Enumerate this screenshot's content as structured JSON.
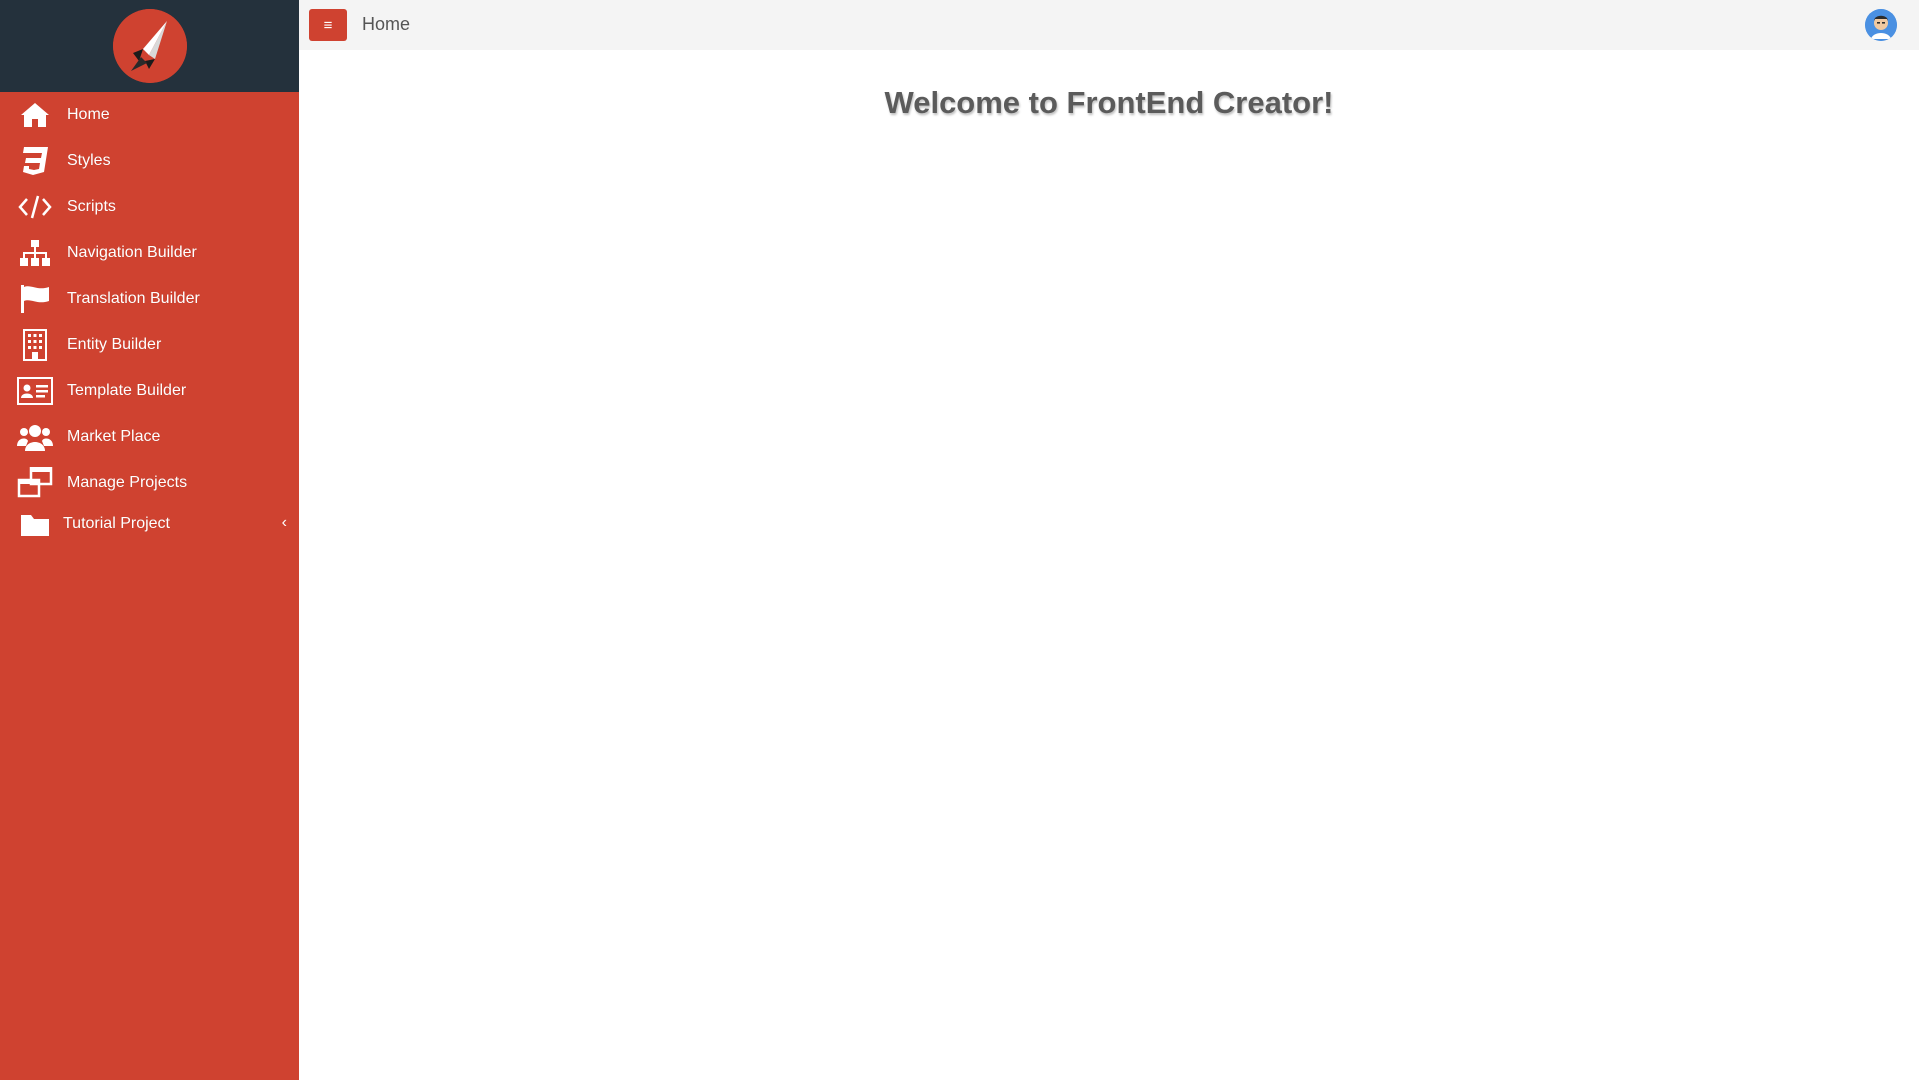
{
  "app": {
    "logo_icon": "rocket-logo-icon",
    "accent_color": "#cf4230",
    "sidebar_header_color": "#24313c"
  },
  "sidebar": {
    "items": [
      {
        "label": "Home",
        "icon": "home-icon"
      },
      {
        "label": "Styles",
        "icon": "css3-icon"
      },
      {
        "label": "Scripts",
        "icon": "code-icon"
      },
      {
        "label": "Navigation Builder",
        "icon": "sitemap-icon"
      },
      {
        "label": "Translation Builder",
        "icon": "flag-icon"
      },
      {
        "label": "Entity Builder",
        "icon": "building-icon"
      },
      {
        "label": "Template Builder",
        "icon": "id-card-icon"
      },
      {
        "label": "Market Place",
        "icon": "users-icon"
      },
      {
        "label": "Manage Projects",
        "icon": "windows-icon"
      },
      {
        "label": "Tutorial Project",
        "icon": "folder-icon"
      }
    ]
  },
  "topbar": {
    "menu_icon": "hamburger-icon",
    "breadcrumb": "Home",
    "avatar_icon": "user-avatar-icon"
  },
  "main": {
    "welcome": "Welcome to FrontEnd Creator!"
  }
}
